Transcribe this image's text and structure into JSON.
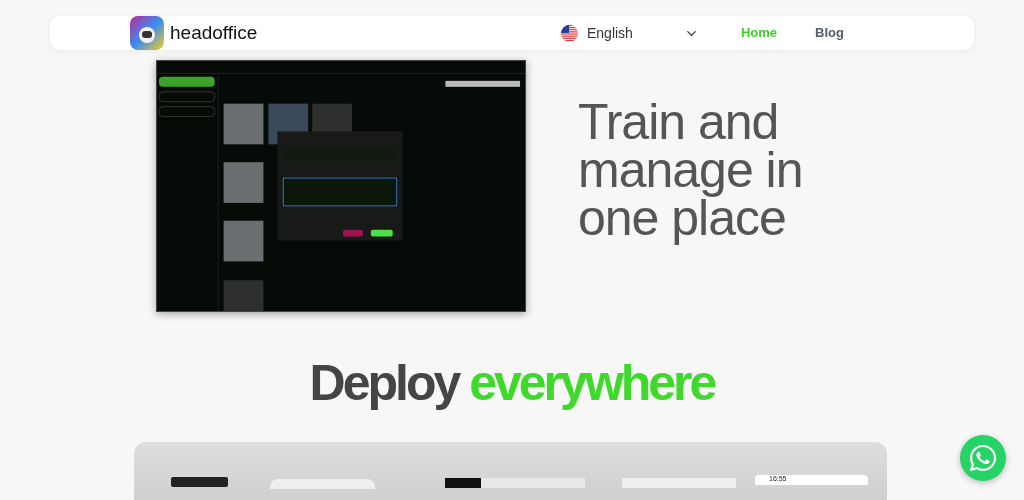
{
  "nav": {
    "brand": "headoffice",
    "language": "English",
    "links": [
      {
        "label": "Home",
        "selected": true
      },
      {
        "label": "Blog",
        "selected": false
      }
    ]
  },
  "headline": "Train and manage in one place",
  "deploy_heading": [
    {
      "text": "Deploy",
      "highlight": false
    },
    {
      "text": "everywhere",
      "highlight": true
    }
  ],
  "devices_panel": {
    "phone_time": "16:55"
  }
}
